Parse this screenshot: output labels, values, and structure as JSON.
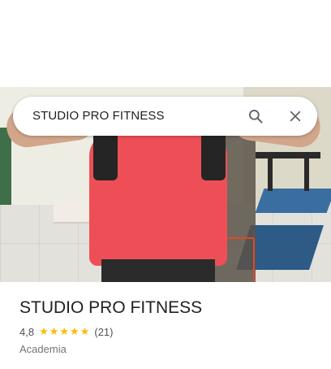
{
  "search": {
    "query": "STUDIO PRO FITNESS"
  },
  "icons": {
    "search": "search-icon",
    "close": "close-icon"
  },
  "place": {
    "name": "STUDIO PRO FITNESS",
    "rating": "4,8",
    "stars": "★★★★★",
    "review_count": "(21)",
    "category": "Academia"
  },
  "colors": {
    "star": "#fbbc04",
    "shirt": "#ee4f57"
  }
}
